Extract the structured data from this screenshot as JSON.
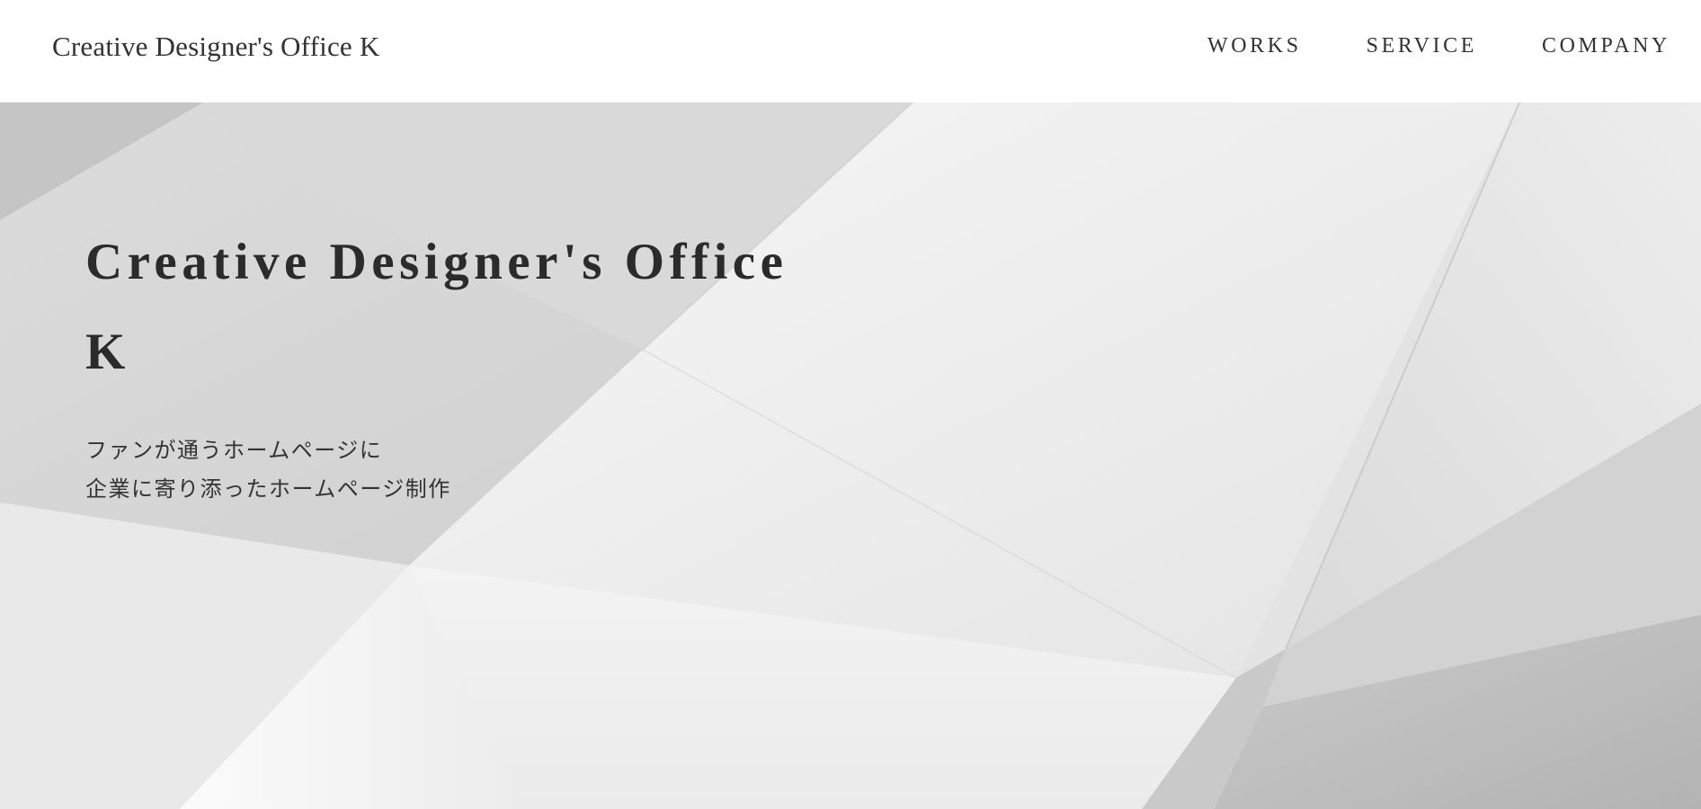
{
  "header": {
    "logo_text": "Creative Designer's Office K",
    "nav": [
      {
        "label": "WORKS"
      },
      {
        "label": "SERVICE"
      },
      {
        "label": "COMPANY"
      }
    ]
  },
  "hero": {
    "title_line1": "Creative Designer's Office",
    "title_line2": "K",
    "subtitle_line1": "ファンが通うホームページに",
    "subtitle_line2": "企業に寄り添ったホームページ制作"
  },
  "colors": {
    "text": "#333333",
    "header_bg": "#ffffff",
    "hero_bg": "#e6e6e6"
  }
}
